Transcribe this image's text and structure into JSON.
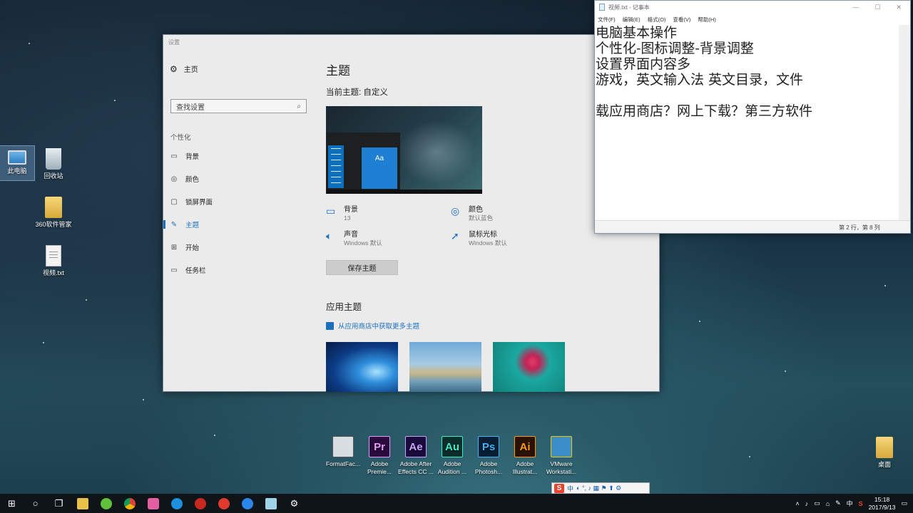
{
  "desktop": {
    "icons": [
      {
        "label": "此电脑",
        "icon": "this-pc-icon"
      },
      {
        "label": "回收站",
        "icon": "recycle-bin-icon"
      },
      {
        "label": "360软件管家",
        "icon": "folder-icon"
      },
      {
        "label": "视频.txt",
        "icon": "text-file-icon"
      },
      {
        "label": "桌面",
        "icon": "folder-icon"
      }
    ],
    "apps": [
      {
        "label1": "FormatFac...",
        "label2": "",
        "glyph": "",
        "bg": "#d8dde2",
        "fg": "#555"
      },
      {
        "label1": "Adobe",
        "label2": "Premie...",
        "glyph": "Pr",
        "bg": "#2a0a3d",
        "fg": "#e79bff"
      },
      {
        "label1": "Adobe After",
        "label2": "Effects CC ...",
        "glyph": "Ae",
        "bg": "#1a0b3c",
        "fg": "#c8a2ff"
      },
      {
        "label1": "Adobe",
        "label2": "Audition ...",
        "glyph": "Au",
        "bg": "#0a2e2a",
        "fg": "#3ef0c8"
      },
      {
        "label1": "Adobe",
        "label2": "Photosh...",
        "glyph": "Ps",
        "bg": "#061e33",
        "fg": "#3fb6ff"
      },
      {
        "label1": "Adobe",
        "label2": "Illustrat...",
        "glyph": "Ai",
        "bg": "#2b1200",
        "fg": "#ff9a00"
      },
      {
        "label1": "VMware",
        "label2": "Workstati...",
        "glyph": "",
        "bg": "#3b8fc9",
        "fg": "#f4c400"
      }
    ]
  },
  "settings": {
    "window_title": "设置",
    "home_label": "主页",
    "search_placeholder": "查找设置",
    "section_label": "个性化",
    "nav": [
      {
        "label": "背景",
        "icon": "picture-icon"
      },
      {
        "label": "颜色",
        "icon": "palette-icon"
      },
      {
        "label": "锁屏界面",
        "icon": "lock-screen-icon"
      },
      {
        "label": "主题",
        "icon": "theme-icon",
        "active": true
      },
      {
        "label": "开始",
        "icon": "start-icon"
      },
      {
        "label": "任务栏",
        "icon": "taskbar-icon"
      }
    ],
    "page_title": "主题",
    "current_theme": "当前主题: 自定义",
    "preview_tile": "Aa",
    "props": {
      "background": {
        "title": "背景",
        "value": "13"
      },
      "color": {
        "title": "颜色",
        "value": "默认蓝色"
      },
      "sound": {
        "title": "声音",
        "value": "Windows 默认"
      },
      "cursor": {
        "title": "鼠标光标",
        "value": "Windows 默认"
      }
    },
    "save_button": "保存主题",
    "apply_heading": "应用主题",
    "store_link": "从应用商店中获取更多主题"
  },
  "notepad": {
    "title": "视频.txt - 记事本",
    "menu": [
      "文件(F)",
      "编辑(E)",
      "格式(O)",
      "查看(V)",
      "帮助(H)"
    ],
    "lines": [
      "电脑基本操作",
      "个性化-图标调整-背景调整",
      "设置界面内容多",
      "游戏，英文输入法 英文目录，文件",
      "",
      "载应用商店？网上下载？第三方软件"
    ],
    "status": "第 2 行，第 8 列"
  },
  "ime": {
    "mode": "中",
    "symbols": "◐ °, ♪ ▦ ⚑ ⬆ ⚙"
  },
  "taskbar": {
    "lang": "中",
    "time": "15:18",
    "date": "2017/9/13"
  }
}
